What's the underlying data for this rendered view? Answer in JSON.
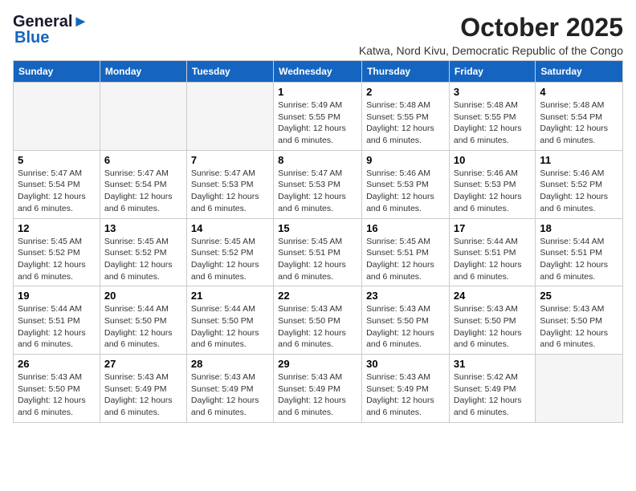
{
  "header": {
    "logo_line1": "General",
    "logo_line2": "Blue",
    "title": "October 2025",
    "subtitle": "Katwa, Nord Kivu, Democratic Republic of the Congo"
  },
  "days_of_week": [
    "Sunday",
    "Monday",
    "Tuesday",
    "Wednesday",
    "Thursday",
    "Friday",
    "Saturday"
  ],
  "weeks": [
    [
      {
        "day": "",
        "empty": true
      },
      {
        "day": "",
        "empty": true
      },
      {
        "day": "",
        "empty": true
      },
      {
        "day": "1",
        "sunrise": "5:49 AM",
        "sunset": "5:55 PM",
        "daylight": "12 hours and 6 minutes."
      },
      {
        "day": "2",
        "sunrise": "5:48 AM",
        "sunset": "5:55 PM",
        "daylight": "12 hours and 6 minutes."
      },
      {
        "day": "3",
        "sunrise": "5:48 AM",
        "sunset": "5:55 PM",
        "daylight": "12 hours and 6 minutes."
      },
      {
        "day": "4",
        "sunrise": "5:48 AM",
        "sunset": "5:54 PM",
        "daylight": "12 hours and 6 minutes."
      }
    ],
    [
      {
        "day": "5",
        "sunrise": "5:47 AM",
        "sunset": "5:54 PM",
        "daylight": "12 hours and 6 minutes."
      },
      {
        "day": "6",
        "sunrise": "5:47 AM",
        "sunset": "5:54 PM",
        "daylight": "12 hours and 6 minutes."
      },
      {
        "day": "7",
        "sunrise": "5:47 AM",
        "sunset": "5:53 PM",
        "daylight": "12 hours and 6 minutes."
      },
      {
        "day": "8",
        "sunrise": "5:47 AM",
        "sunset": "5:53 PM",
        "daylight": "12 hours and 6 minutes."
      },
      {
        "day": "9",
        "sunrise": "5:46 AM",
        "sunset": "5:53 PM",
        "daylight": "12 hours and 6 minutes."
      },
      {
        "day": "10",
        "sunrise": "5:46 AM",
        "sunset": "5:53 PM",
        "daylight": "12 hours and 6 minutes."
      },
      {
        "day": "11",
        "sunrise": "5:46 AM",
        "sunset": "5:52 PM",
        "daylight": "12 hours and 6 minutes."
      }
    ],
    [
      {
        "day": "12",
        "sunrise": "5:45 AM",
        "sunset": "5:52 PM",
        "daylight": "12 hours and 6 minutes."
      },
      {
        "day": "13",
        "sunrise": "5:45 AM",
        "sunset": "5:52 PM",
        "daylight": "12 hours and 6 minutes."
      },
      {
        "day": "14",
        "sunrise": "5:45 AM",
        "sunset": "5:52 PM",
        "daylight": "12 hours and 6 minutes."
      },
      {
        "day": "15",
        "sunrise": "5:45 AM",
        "sunset": "5:51 PM",
        "daylight": "12 hours and 6 minutes."
      },
      {
        "day": "16",
        "sunrise": "5:45 AM",
        "sunset": "5:51 PM",
        "daylight": "12 hours and 6 minutes."
      },
      {
        "day": "17",
        "sunrise": "5:44 AM",
        "sunset": "5:51 PM",
        "daylight": "12 hours and 6 minutes."
      },
      {
        "day": "18",
        "sunrise": "5:44 AM",
        "sunset": "5:51 PM",
        "daylight": "12 hours and 6 minutes."
      }
    ],
    [
      {
        "day": "19",
        "sunrise": "5:44 AM",
        "sunset": "5:51 PM",
        "daylight": "12 hours and 6 minutes."
      },
      {
        "day": "20",
        "sunrise": "5:44 AM",
        "sunset": "5:50 PM",
        "daylight": "12 hours and 6 minutes."
      },
      {
        "day": "21",
        "sunrise": "5:44 AM",
        "sunset": "5:50 PM",
        "daylight": "12 hours and 6 minutes."
      },
      {
        "day": "22",
        "sunrise": "5:43 AM",
        "sunset": "5:50 PM",
        "daylight": "12 hours and 6 minutes."
      },
      {
        "day": "23",
        "sunrise": "5:43 AM",
        "sunset": "5:50 PM",
        "daylight": "12 hours and 6 minutes."
      },
      {
        "day": "24",
        "sunrise": "5:43 AM",
        "sunset": "5:50 PM",
        "daylight": "12 hours and 6 minutes."
      },
      {
        "day": "25",
        "sunrise": "5:43 AM",
        "sunset": "5:50 PM",
        "daylight": "12 hours and 6 minutes."
      }
    ],
    [
      {
        "day": "26",
        "sunrise": "5:43 AM",
        "sunset": "5:50 PM",
        "daylight": "12 hours and 6 minutes."
      },
      {
        "day": "27",
        "sunrise": "5:43 AM",
        "sunset": "5:49 PM",
        "daylight": "12 hours and 6 minutes."
      },
      {
        "day": "28",
        "sunrise": "5:43 AM",
        "sunset": "5:49 PM",
        "daylight": "12 hours and 6 minutes."
      },
      {
        "day": "29",
        "sunrise": "5:43 AM",
        "sunset": "5:49 PM",
        "daylight": "12 hours and 6 minutes."
      },
      {
        "day": "30",
        "sunrise": "5:43 AM",
        "sunset": "5:49 PM",
        "daylight": "12 hours and 6 minutes."
      },
      {
        "day": "31",
        "sunrise": "5:42 AM",
        "sunset": "5:49 PM",
        "daylight": "12 hours and 6 minutes."
      },
      {
        "day": "",
        "empty": true
      }
    ]
  ],
  "labels": {
    "sunrise": "Sunrise:",
    "sunset": "Sunset:",
    "daylight": "Daylight:"
  }
}
